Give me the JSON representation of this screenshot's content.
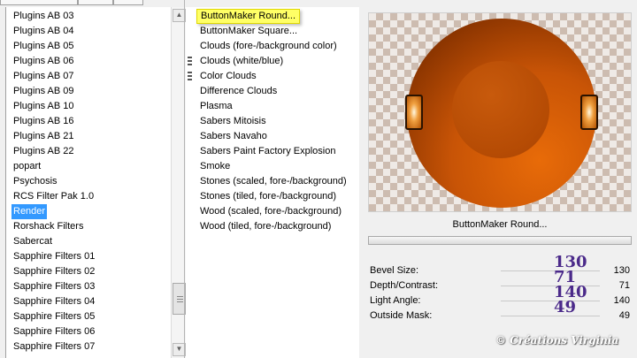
{
  "categories": [
    "Plugins AB 03",
    "Plugins AB 04",
    "Plugins AB 05",
    "Plugins AB 06",
    "Plugins AB 07",
    "Plugins AB 09",
    "Plugins AB 10",
    "Plugins AB 16",
    "Plugins AB 21",
    "Plugins AB 22",
    "popart",
    "Psychosis",
    "RCS Filter Pak 1.0",
    "Render",
    "Rorshack Filters",
    "Sabercat",
    "Sapphire Filters 01",
    "Sapphire Filters 02",
    "Sapphire Filters 03",
    "Sapphire Filters 04",
    "Sapphire Filters 05",
    "Sapphire Filters 06",
    "Sapphire Filters 07"
  ],
  "selected_category": "Render",
  "filters": [
    "ButtonMaker Round...",
    "ButtonMaker Square...",
    "Clouds (fore-/background color)",
    "Clouds (white/blue)",
    "Color Clouds",
    "Difference Clouds",
    "Plasma",
    "Sabers Mitoisis",
    "Sabers Navaho",
    "Sabers Paint Factory Explosion",
    "Smoke",
    "Stones (scaled, fore-/background)",
    "Stones (tiled, fore-/background)",
    "Wood (scaled, fore-/background)",
    "Wood (tiled, fore-/background)"
  ],
  "highlighted_filter": "ButtonMaker Round...",
  "preview": {
    "title": "ButtonMaker Round..."
  },
  "params": [
    {
      "label": "Bevel Size:",
      "value": "130",
      "annotation": "130"
    },
    {
      "label": "Depth/Contrast:",
      "value": "71",
      "annotation": "71"
    },
    {
      "label": "Light Angle:",
      "value": "140",
      "annotation": "140"
    },
    {
      "label": "Outside Mask:",
      "value": "49",
      "annotation": "49"
    }
  ],
  "watermark": "© Créations Virginia",
  "colors": {
    "selection": "#3399ff",
    "highlight": "#ffff66",
    "annotation": "#4b2a8a",
    "button_orange": "#e86b08"
  }
}
